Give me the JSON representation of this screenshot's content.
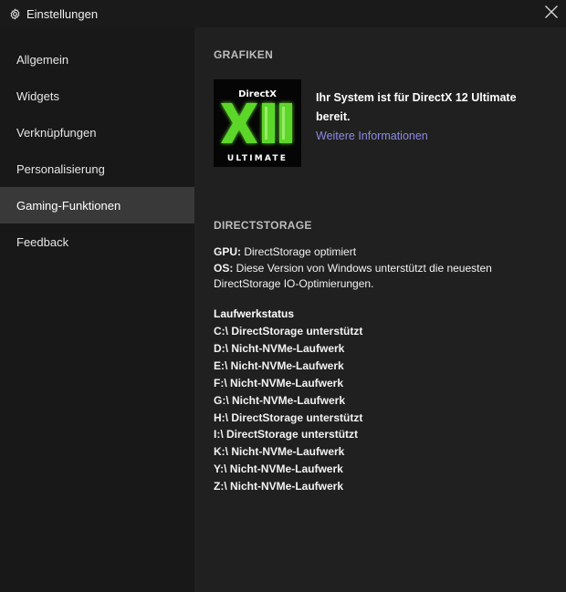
{
  "window": {
    "title": "Einstellungen",
    "settings_icon": "gear-icon",
    "close_icon": "close-icon"
  },
  "sidebar": {
    "active_index": 4,
    "items": [
      {
        "label": "Allgemein"
      },
      {
        "label": "Widgets"
      },
      {
        "label": "Verknüpfungen"
      },
      {
        "label": "Personalisierung"
      },
      {
        "label": "Gaming-Funktionen"
      },
      {
        "label": "Feedback"
      }
    ]
  },
  "graphics": {
    "header": "GRAFIKEN",
    "logo": {
      "top": "DirectX",
      "numeral": "XII",
      "bottom": "ULTIMATE",
      "accent": "#5dd62c"
    },
    "status_text": "Ihr System ist für DirectX 12 Ultimate bereit.",
    "link": "Weitere Informationen",
    "link_color": "#8e8ae0"
  },
  "directstorage": {
    "header": "DIRECTSTORAGE",
    "gpu_key": "GPU:",
    "gpu_value": " DirectStorage optimiert",
    "os_key": "OS:",
    "os_value": " Diese Version von Windows unterstützt die neuesten DirectStorage IO-Optimierungen.",
    "drives_title": "Laufwerkstatus",
    "drives": [
      "C:\\ DirectStorage unterstützt",
      "D:\\ Nicht-NVMe-Laufwerk",
      "E:\\ Nicht-NVMe-Laufwerk",
      "F:\\ Nicht-NVMe-Laufwerk",
      "G:\\ Nicht-NVMe-Laufwerk",
      "H:\\ DirectStorage unterstützt",
      "I:\\ DirectStorage unterstützt",
      "K:\\ Nicht-NVMe-Laufwerk",
      "Y:\\ Nicht-NVMe-Laufwerk",
      "Z:\\ Nicht-NVMe-Laufwerk"
    ]
  }
}
